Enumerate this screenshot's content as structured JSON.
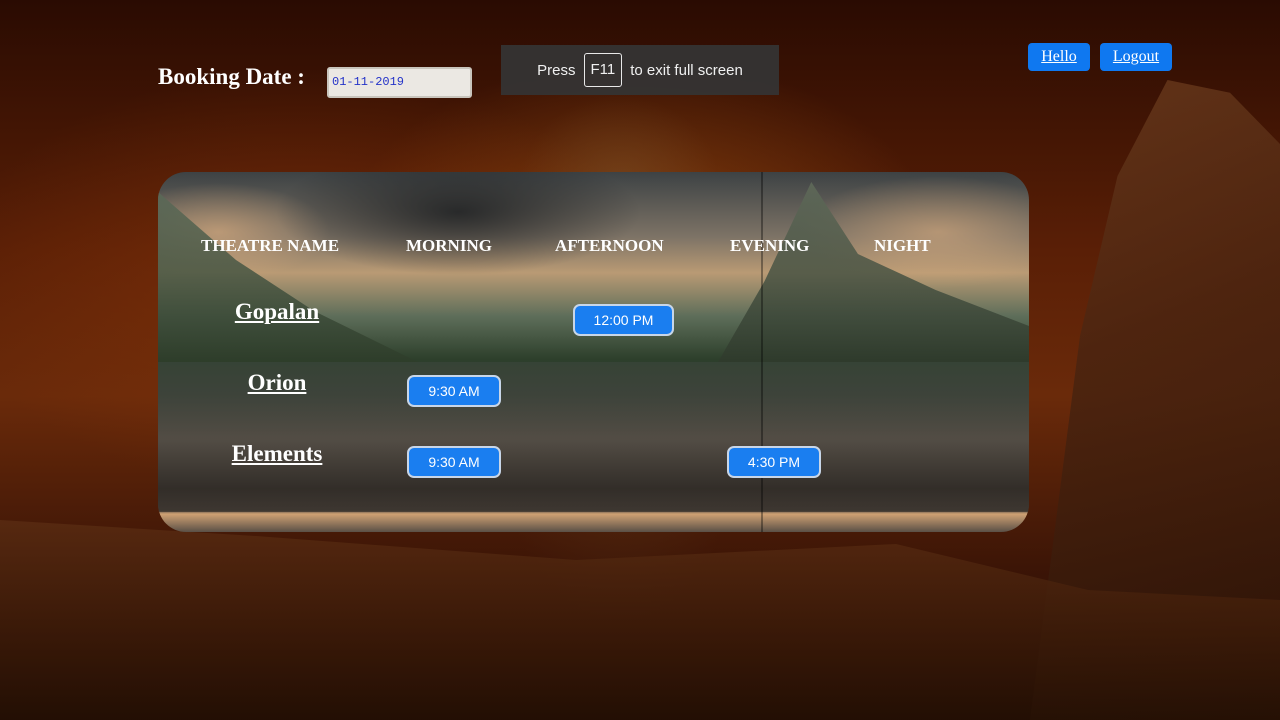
{
  "booking": {
    "label": "Booking Date :",
    "date_value": "01-11-2019"
  },
  "fullscreen_notice": {
    "prefix": "Press",
    "key": "F11",
    "suffix": "to exit full screen"
  },
  "header_buttons": {
    "hello": "Hello",
    "logout": "Logout"
  },
  "schedule": {
    "columns": [
      "THEATRE NAME",
      "MORNING",
      "AFTERNOON",
      "EVENING",
      "NIGHT"
    ],
    "theatres": [
      {
        "name": "Gopalan",
        "morning": "",
        "afternoon": "12:00 PM",
        "evening": "",
        "night": ""
      },
      {
        "name": "Orion",
        "morning": "9:30 AM",
        "afternoon": "",
        "evening": "",
        "night": ""
      },
      {
        "name": "Elements",
        "morning": "9:30 AM",
        "afternoon": "",
        "evening": "4:30 PM",
        "night": ""
      }
    ]
  }
}
